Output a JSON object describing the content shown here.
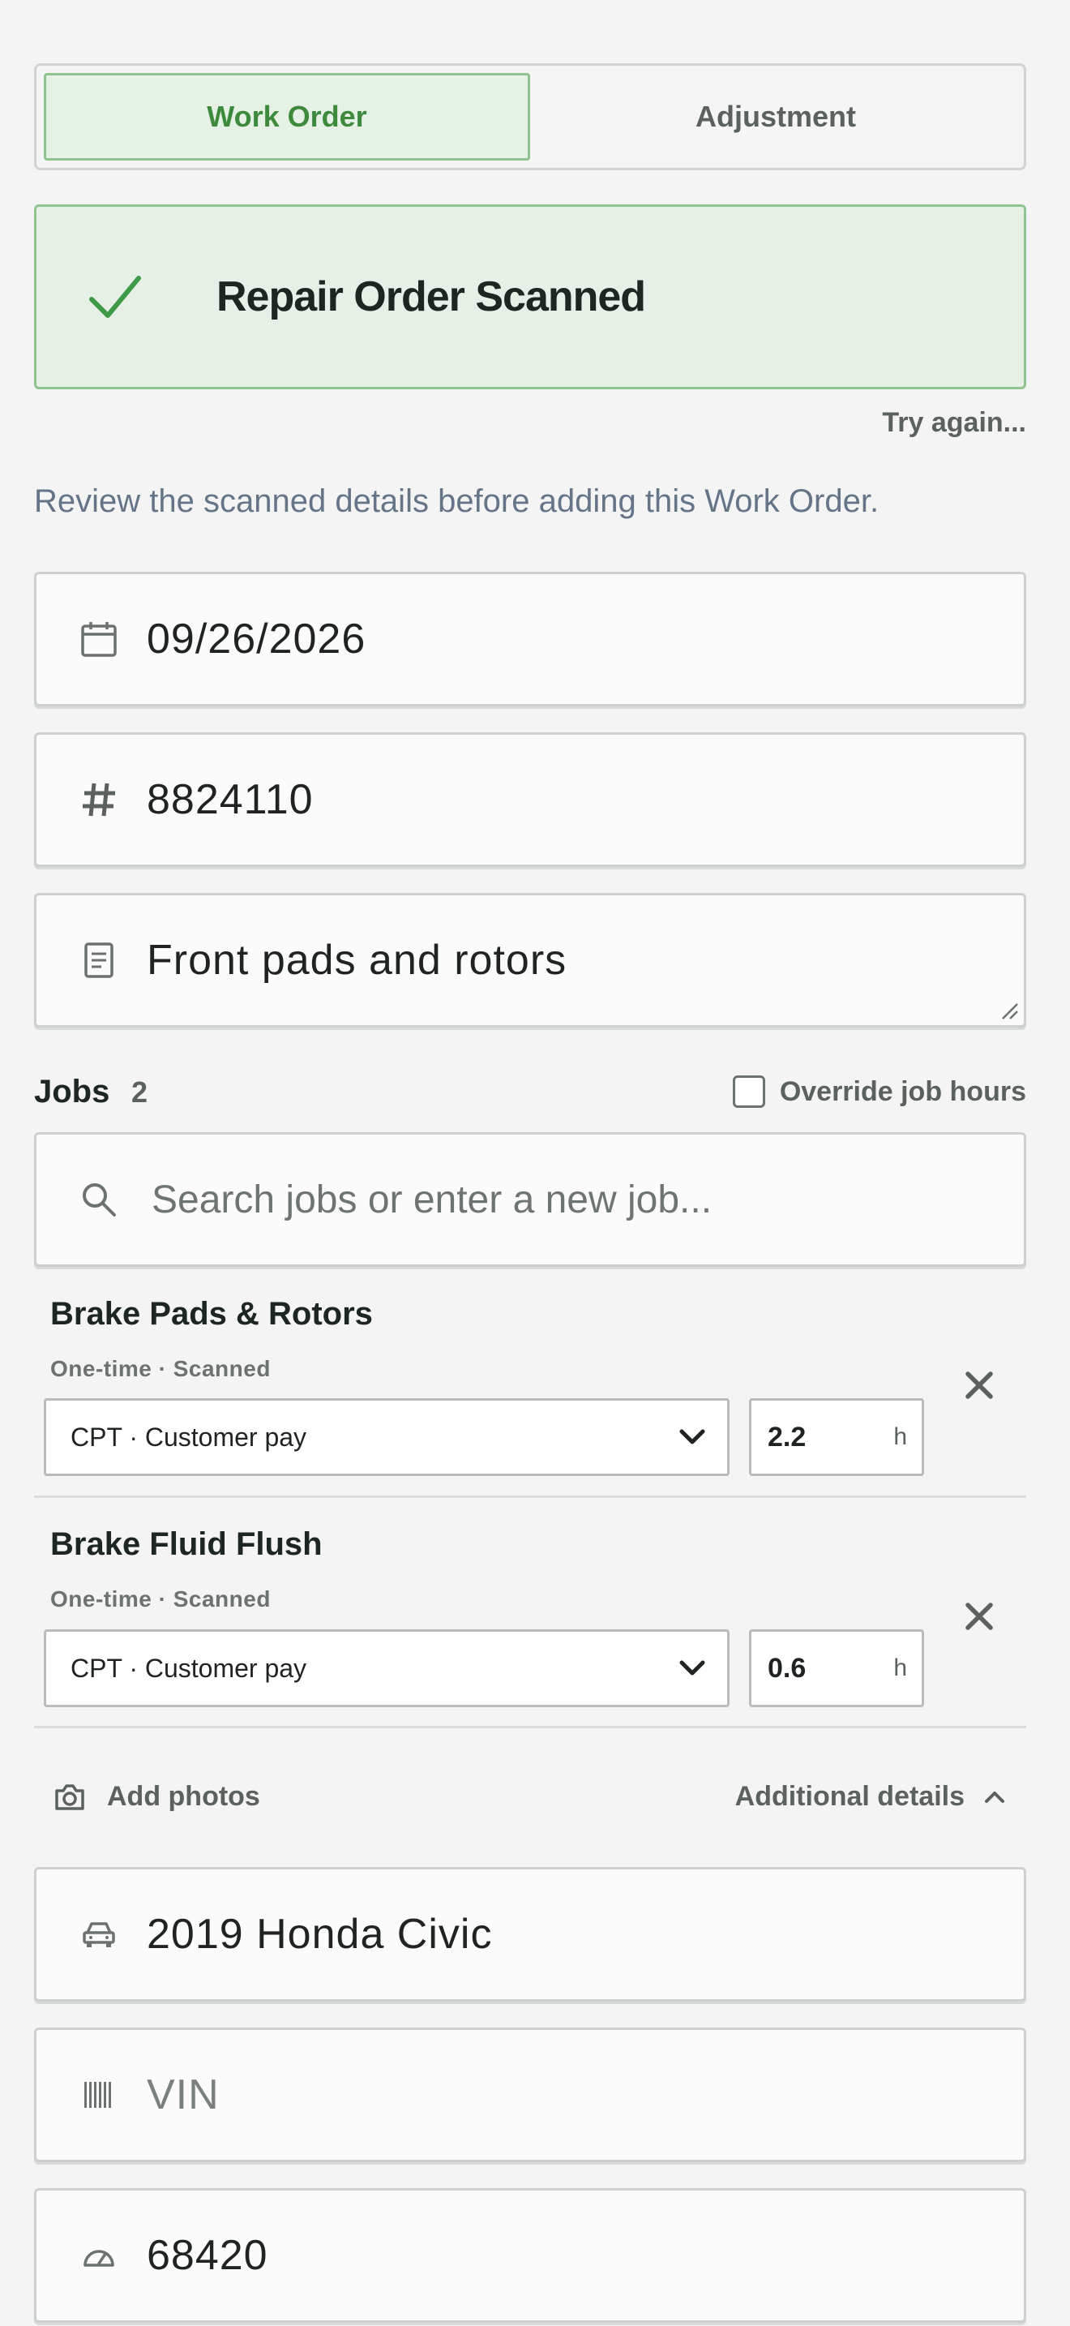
{
  "segmented": {
    "options": [
      "Work Order",
      "Adjustment"
    ],
    "selected": "Work Order"
  },
  "banner": {
    "title": "Repair Order Scanned"
  },
  "try_again": "Try again...",
  "review_text": "Review the scanned details before adding this Work Order.",
  "date_field": {
    "value": "09/26/2026",
    "icon": "calendar-icon"
  },
  "ro_number_field": {
    "value": "8824110",
    "icon": "hash-icon"
  },
  "description_field": {
    "value": "Front pads and rotors",
    "icon": "document-icon"
  },
  "jobs": {
    "label": "Jobs",
    "count": "2",
    "override_label": "Override job hours",
    "override_checked": false,
    "search_placeholder": "Search jobs or enter a new job...",
    "items": [
      {
        "title": "Brake Pads & Rotors",
        "subtitle": "One-time · Scanned",
        "pay_type": "CPT · Customer pay",
        "hours": "2.2",
        "unit": "h"
      },
      {
        "title": "Brake Fluid Flush",
        "subtitle": "One-time · Scanned",
        "pay_type": "CPT · Customer pay",
        "hours": "0.6",
        "unit": "h"
      }
    ]
  },
  "add_photos": "Add photos",
  "additional_details": "Additional details",
  "vehicle_field": {
    "value": "2019 Honda Civic",
    "icon": "car-icon"
  },
  "vin_field": {
    "placeholder": "VIN",
    "icon": "barcode-icon"
  },
  "mileage_field": {
    "value": "68420",
    "icon": "speedometer-icon"
  },
  "colors": {
    "accent": "#3d8a3d",
    "accent_bg": "#e4f1e4",
    "muted_text": "#5b625d",
    "border": "#cdd1ce"
  }
}
